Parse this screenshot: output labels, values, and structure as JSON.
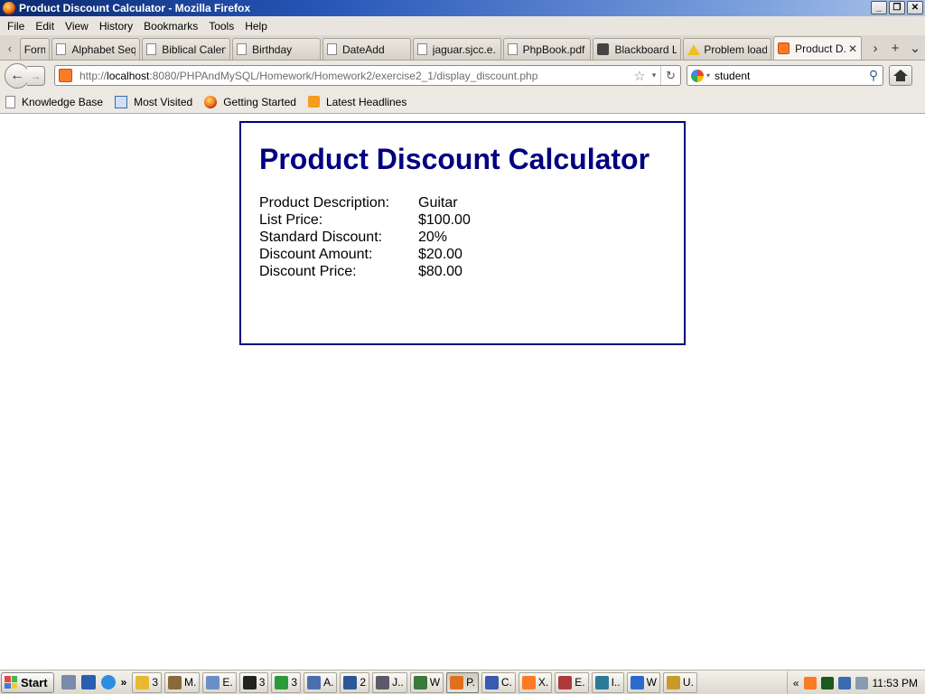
{
  "window": {
    "title": "Product Discount Calculator - Mozilla Firefox",
    "min_glyph": "_",
    "max_glyph": "❐",
    "close_glyph": "✕"
  },
  "menu": [
    "File",
    "Edit",
    "View",
    "History",
    "Bookmarks",
    "Tools",
    "Help"
  ],
  "tabs": [
    {
      "label": "Form",
      "icon": "none"
    },
    {
      "label": "Alphabet Seq...",
      "icon": "page"
    },
    {
      "label": "Biblical Calen...",
      "icon": "page"
    },
    {
      "label": "Birthday",
      "icon": "page"
    },
    {
      "label": "DateAdd",
      "icon": "page"
    },
    {
      "label": "jaguar.sjcc.e...",
      "icon": "page"
    },
    {
      "label": "PhpBook.pdf ...",
      "icon": "page"
    },
    {
      "label": "Blackboard L...",
      "icon": "blackboard"
    },
    {
      "label": "Problem loadi...",
      "icon": "warning"
    },
    {
      "label": "Product D...",
      "icon": "xampp",
      "active": true
    }
  ],
  "tab_controls": {
    "scroll_left": "‹",
    "scroll_right": "›",
    "new_tab": "+",
    "list_all": "⌄",
    "close": "✕"
  },
  "nav": {
    "back": "←",
    "forward": "→",
    "url_prefix": "http://",
    "url_host": "localhost",
    "url_rest": ":8080/PHPAndMySQL/Homework/Homework2/exercise2_1/display_discount.php",
    "star": "☆",
    "dropdown": "▾",
    "reload": "↻",
    "search_value": "student",
    "search_glass": "⚲"
  },
  "bookmarks": [
    {
      "label": "Knowledge Base",
      "icon": "page"
    },
    {
      "label": "Most Visited",
      "icon": "most-visited"
    },
    {
      "label": "Getting Started",
      "icon": "firefox"
    },
    {
      "label": "Latest Headlines",
      "icon": "rss"
    }
  ],
  "page": {
    "title": "Product Discount Calculator",
    "rows": [
      {
        "label": "Product Description:",
        "value": "Guitar"
      },
      {
        "label": "List Price:",
        "value": "$100.00"
      },
      {
        "label": "Standard Discount:",
        "value": "20%"
      },
      {
        "label": "Discount Amount:",
        "value": "$20.00"
      },
      {
        "label": "Discount Price:",
        "value": "$80.00"
      }
    ],
    "title_color": "#000080",
    "border_color": "#000080"
  },
  "taskbar": {
    "start_label": "Start",
    "more": "»",
    "tasks": [
      {
        "label": "3",
        "color": "#e8b830",
        "name": "explorer-group"
      },
      {
        "label": "M.",
        "color": "#8a6a3a",
        "name": "task-m"
      },
      {
        "label": "E.",
        "color": "#6a8fc8",
        "name": "task-e"
      },
      {
        "label": "3",
        "color": "#222222",
        "name": "cmd-group"
      },
      {
        "label": "3",
        "color": "#2c9a3a",
        "name": "chrome-group"
      },
      {
        "label": "A.",
        "color": "#4a6fb0",
        "name": "task-a"
      },
      {
        "label": "2",
        "color": "#2b5797",
        "name": "word-group"
      },
      {
        "label": "J..",
        "color": "#5a5a6a",
        "name": "task-j"
      },
      {
        "label": "W",
        "color": "#3a7a3a",
        "name": "task-w"
      },
      {
        "label": "P.",
        "color": "#e0701e",
        "name": "firefox-task",
        "active": true
      },
      {
        "label": "C.",
        "color": "#3a5ab0",
        "name": "task-c"
      },
      {
        "label": "X.",
        "color": "#fb7a24",
        "name": "xampp-task"
      },
      {
        "label": "E.",
        "color": "#b03a3a",
        "name": "task-e2"
      },
      {
        "label": "I..",
        "color": "#2a7a9a",
        "name": "task-i"
      },
      {
        "label": "W",
        "color": "#2a6ad0",
        "name": "help-task"
      },
      {
        "label": "U.",
        "color": "#c89a2a",
        "name": "task-u"
      }
    ],
    "tray_chevron": "«",
    "clock": "11:53 PM"
  }
}
